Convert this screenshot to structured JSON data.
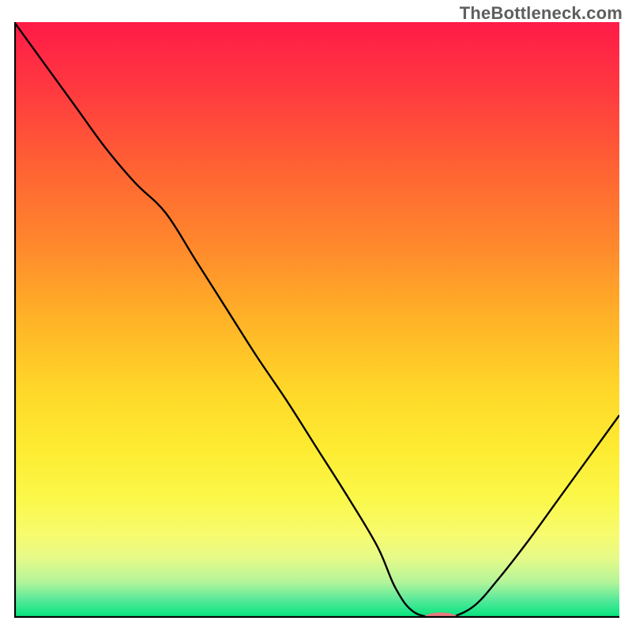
{
  "watermark": "TheBottleneck.com",
  "chart_data": {
    "type": "line",
    "title": "",
    "xlabel": "",
    "ylabel": "",
    "xlim": [
      0,
      100
    ],
    "ylim": [
      0,
      100
    ],
    "grid": false,
    "legend": false,
    "background_gradient_stops": [
      {
        "offset": 0.0,
        "color": "#ff1b48"
      },
      {
        "offset": 0.12,
        "color": "#ff3b3f"
      },
      {
        "offset": 0.25,
        "color": "#ff6433"
      },
      {
        "offset": 0.38,
        "color": "#ff8a2c"
      },
      {
        "offset": 0.5,
        "color": "#ffb327"
      },
      {
        "offset": 0.62,
        "color": "#ffd829"
      },
      {
        "offset": 0.72,
        "color": "#fdec32"
      },
      {
        "offset": 0.8,
        "color": "#fbf84a"
      },
      {
        "offset": 0.86,
        "color": "#f7fb6e"
      },
      {
        "offset": 0.9,
        "color": "#e6fa89"
      },
      {
        "offset": 0.94,
        "color": "#b4f49a"
      },
      {
        "offset": 0.97,
        "color": "#57e99a"
      },
      {
        "offset": 1.0,
        "color": "#00e47c"
      }
    ],
    "series": [
      {
        "name": "curve",
        "color": "#000000",
        "stroke_width": 2.4,
        "x": [
          0.0,
          5.0,
          10.0,
          15.0,
          20.0,
          25.0,
          30.0,
          35.0,
          40.0,
          45.0,
          50.0,
          55.0,
          60.0,
          63.0,
          66.0,
          70.0,
          72.0,
          76.0,
          80.0,
          85.0,
          90.0,
          95.0,
          100.0
        ],
        "y": [
          100.0,
          93.0,
          86.0,
          79.0,
          73.0,
          68.0,
          60.0,
          52.0,
          44.0,
          36.5,
          28.5,
          20.5,
          12.0,
          5.0,
          1.0,
          0.0,
          0.0,
          2.0,
          6.5,
          13.0,
          20.0,
          27.0,
          34.0
        ]
      }
    ],
    "marker": {
      "name": "optimum-marker",
      "x": 70.5,
      "y": 0.0,
      "rx": 2.8,
      "ry": 0.9,
      "color": "#e77a80"
    }
  }
}
